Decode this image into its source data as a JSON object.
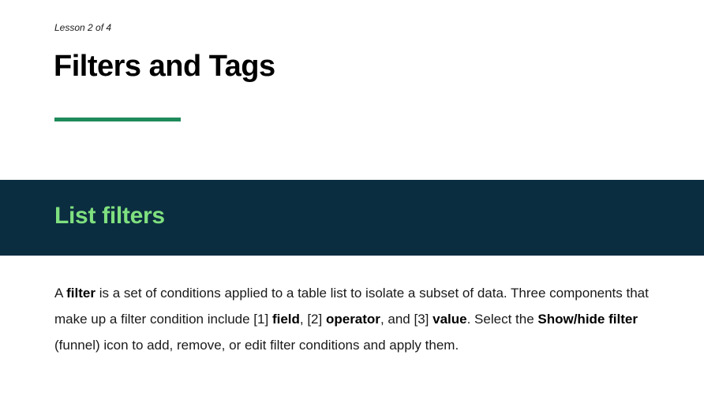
{
  "lesson": {
    "counter": "Lesson 2 of 4",
    "title": "Filters and Tags"
  },
  "section": {
    "heading": "List filters"
  },
  "paragraph": {
    "t1": "A ",
    "b1": "filter",
    "t2": " is a set of conditions applied to a table list to isolate a subset of data. Three components that make up a filter condition include [1] ",
    "b2": "field",
    "t3": ", [2] ",
    "b3": "operator",
    "t4": ", and [3] ",
    "b4": "value",
    "t5": ". Select the ",
    "b5": "Show/hide filter",
    "t6": " (funnel) icon to add, remove, or edit filter conditions and apply them."
  },
  "colors": {
    "accent_green": "#1f8a5b",
    "band_navy": "#0b2d40",
    "heading_green": "#7fe07f"
  }
}
